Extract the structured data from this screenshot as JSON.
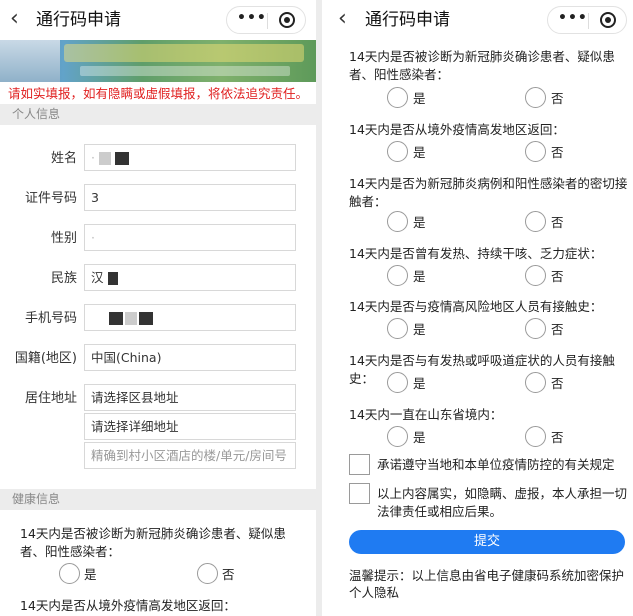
{
  "nav": {
    "back_icon": "‹",
    "title": "通行码申请",
    "more_icon": "•••",
    "close_icon": "target-icon"
  },
  "warning": "请如实填报，如有隐瞒或虚假填报，将依法追究责任。",
  "personal": {
    "section_title": "个人信息",
    "fields": [
      {
        "label": "姓名",
        "value": "",
        "masked": true
      },
      {
        "label": "证件号码",
        "value": "3"
      },
      {
        "label": "性别",
        "value": ""
      },
      {
        "label": "民族",
        "value": "汉",
        "masked": true
      },
      {
        "label": "手机号码",
        "value": "",
        "masked": true
      },
      {
        "label": "国籍(地区)",
        "value": "中国(China)"
      },
      {
        "label": "居住地址",
        "value": "请选择区县地址"
      }
    ],
    "address_detail": "请选择详细地址",
    "address_placeholder": "精确到村小区酒店的楼/单元/房间号"
  },
  "health": {
    "section_title": "健康信息",
    "yes": "是",
    "no": "否",
    "questions": [
      "14天内是否被诊断为新冠肺炎确诊患者、疑似患者、阳性感染者：",
      "14天内是否从境外疫情高发地区返回：",
      "14天内是否为新冠肺炎病例和阳性感染者的密切接触者：",
      "14天内是否曾有发热、持续干咳、乏力症状：",
      "14天内是否与疫情高风险地区人员有接触史：",
      "14天内是否与有发热或呼吸道症状的人员有接触史：",
      "14天内一直在山东省境内："
    ]
  },
  "agreements": {
    "item1": "承诺遵守当地和本单位疫情防控的有关规定",
    "item2": "以上内容属实，如隐瞒、虚报，本人承担一切法律责任或相应后果。"
  },
  "submit_label": "提交",
  "tip": "温馨提示：以上信息由省电子健康码系统加密保护个人隐私"
}
